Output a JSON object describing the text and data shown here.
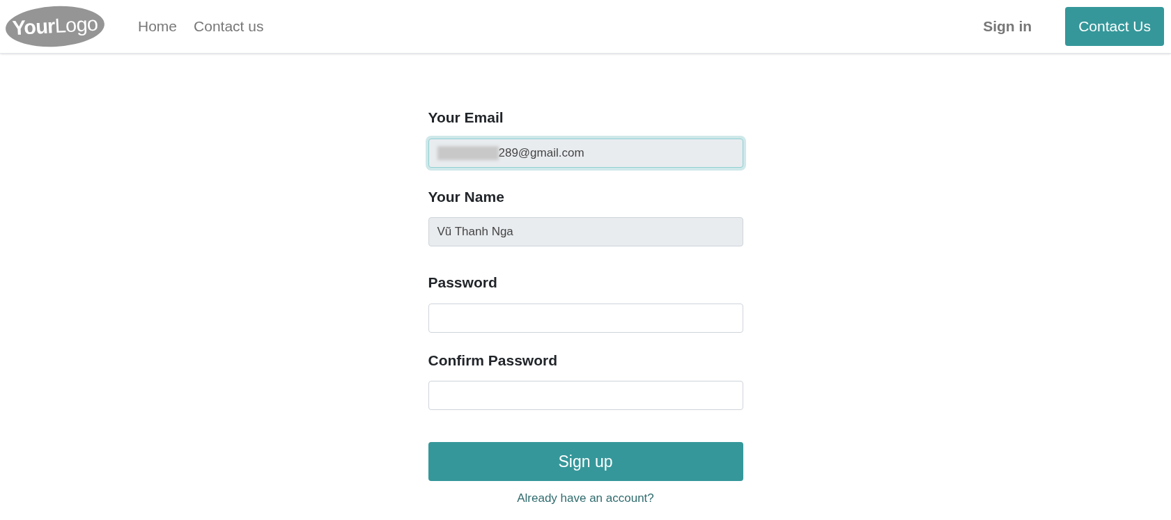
{
  "header": {
    "logo": "**Your**Logo",
    "nav": [
      {
        "label": "Home"
      },
      {
        "label": "Contact us"
      }
    ],
    "sign_in": "Sign in",
    "cta": "Contact Us"
  },
  "form": {
    "fields": [
      {
        "label": "Your Email",
        "value": "289@gmail.com",
        "readonly": true,
        "focused": true,
        "redacted": true
      },
      {
        "label": "Your Name",
        "value": "Vũ Thanh Nga",
        "readonly": true,
        "focused": false,
        "redacted": false
      },
      {
        "label": "Password",
        "readonly": false,
        "focused": false,
        "redacted": false
      },
      {
        "label": "Confirm Password",
        "readonly": false,
        "focused": false,
        "redacted": false
      }
    ],
    "submit": "Sign up",
    "link": "Already have an account?"
  }
}
